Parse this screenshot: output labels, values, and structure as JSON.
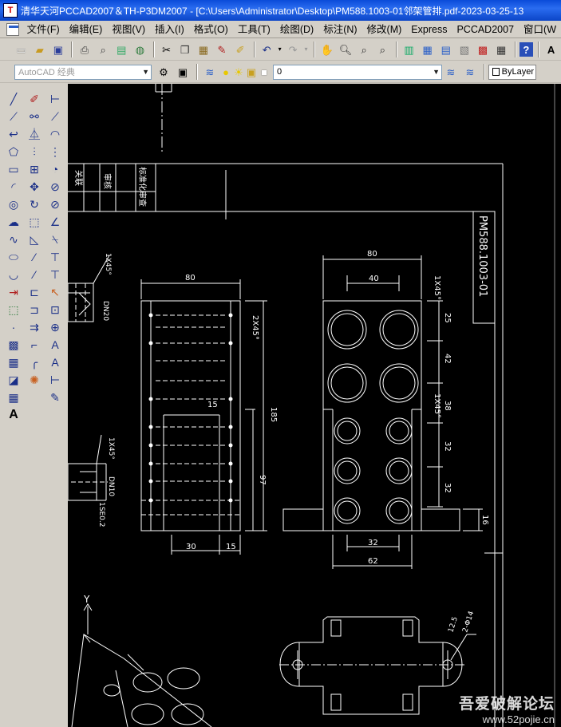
{
  "titlebar": {
    "title": "清华天河PCCAD2007＆TH-P3DM2007 - [C:\\Users\\Administrator\\Desktop\\PM588.1003-01邻架管排.pdf-2023-03-25-13"
  },
  "menu": [
    "文件(F)",
    "编辑(E)",
    "视图(V)",
    "插入(I)",
    "格式(O)",
    "工具(T)",
    "绘图(D)",
    "标注(N)",
    "修改(M)",
    "Express",
    "PCCAD2007",
    "窗口(W"
  ],
  "toolbar2": {
    "workspace": "AutoCAD 经典",
    "layer": "0",
    "linetype": "ByLayer"
  },
  "drawing": {
    "part_number": "PM588.1003-01",
    "title_cells": [
      "关联",
      "审核",
      "标准化审查"
    ],
    "front_view_dims": [
      "80",
      "2X45°",
      "185",
      "97",
      "15",
      "30",
      "15"
    ],
    "side_view_dims": [
      "80",
      "40",
      "1X45°",
      "25",
      "42",
      "38",
      "32",
      "32",
      "1X45°",
      "16",
      "32",
      "62"
    ],
    "section_labels": [
      "1X45°",
      "DN20",
      "1X45°",
      "DN10",
      "1SE0.2"
    ],
    "bottom_labels": [
      "2-Φ14",
      "12.5",
      "Y"
    ]
  },
  "watermark": {
    "line1": "吾爱破解论坛",
    "line2": "www.52pojie.cn"
  }
}
